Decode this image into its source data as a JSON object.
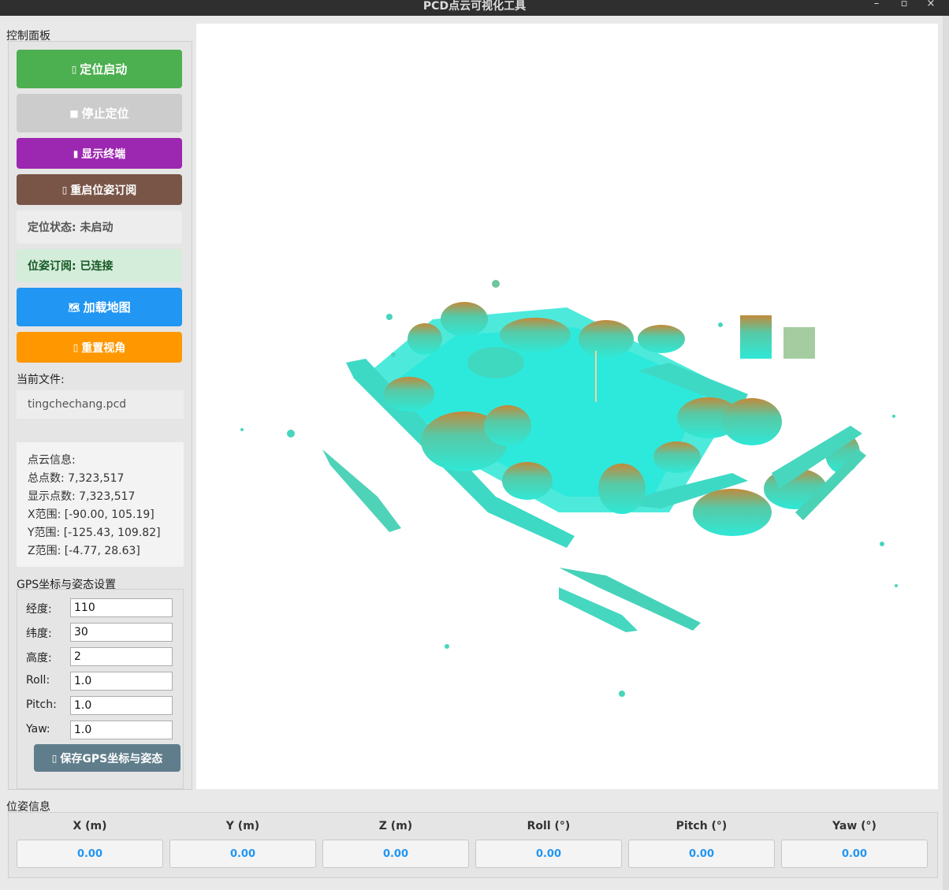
{
  "window": {
    "title": "PCD点云可视化工具",
    "minimize": "–",
    "maximize": "▫",
    "close": "×"
  },
  "control_panel": {
    "title": "控制面板",
    "buttons": {
      "start_localization": {
        "icon": "▯",
        "label": "定位启动",
        "color": "#4caf50"
      },
      "stop_localization": {
        "icon": "■",
        "label": "停止定位",
        "color": "#cccccc"
      },
      "show_terminal": {
        "icon": "▮",
        "label": "显示终端",
        "color": "#9c27b0"
      },
      "restart_pose_sub": {
        "icon": "▯",
        "label": "重启位姿订阅",
        "color": "#795548"
      },
      "load_map": {
        "icon": "🗺",
        "label": "加载地图",
        "color": "#2196f3"
      },
      "reset_view": {
        "icon": "▯",
        "label": "重置视角",
        "color": "#ff9800"
      }
    },
    "localization_status": "定位状态: 未启动",
    "pose_subscription_status": "位姿订阅: 已连接",
    "current_file_label": "当前文件:",
    "current_file": "tingchechang.pcd",
    "cloud_info": {
      "header": "点云信息:",
      "total_points": "总点数: 7,323,517",
      "shown_points": "显示点数: 7,323,517",
      "x_range": "X范围: [-90.00, 105.19]",
      "y_range": "Y范围: [-125.43, 109.82]",
      "z_range": "Z范围: [-4.77, 28.63]"
    }
  },
  "gps": {
    "title": "GPS坐标与姿态设置",
    "fields": [
      {
        "label": "经度:",
        "value": "110"
      },
      {
        "label": "纬度:",
        "value": "30"
      },
      {
        "label": "高度:",
        "value": "2"
      },
      {
        "label": "Roll:",
        "value": "1.0"
      },
      {
        "label": "Pitch:",
        "value": "1.0"
      },
      {
        "label": "Yaw:",
        "value": "1.0"
      }
    ],
    "save_button": {
      "icon": "▯",
      "label": "保存GPS坐标与姿态",
      "color": "#607d8b"
    }
  },
  "pose": {
    "title": "位姿信息",
    "columns": [
      {
        "label": "X (m)",
        "value": "0.00"
      },
      {
        "label": "Y (m)",
        "value": "0.00"
      },
      {
        "label": "Z (m)",
        "value": "0.00"
      },
      {
        "label": "Roll (°)",
        "value": "0.00"
      },
      {
        "label": "Pitch (°)",
        "value": "0.00"
      },
      {
        "label": "Yaw (°)",
        "value": "0.00"
      }
    ]
  }
}
